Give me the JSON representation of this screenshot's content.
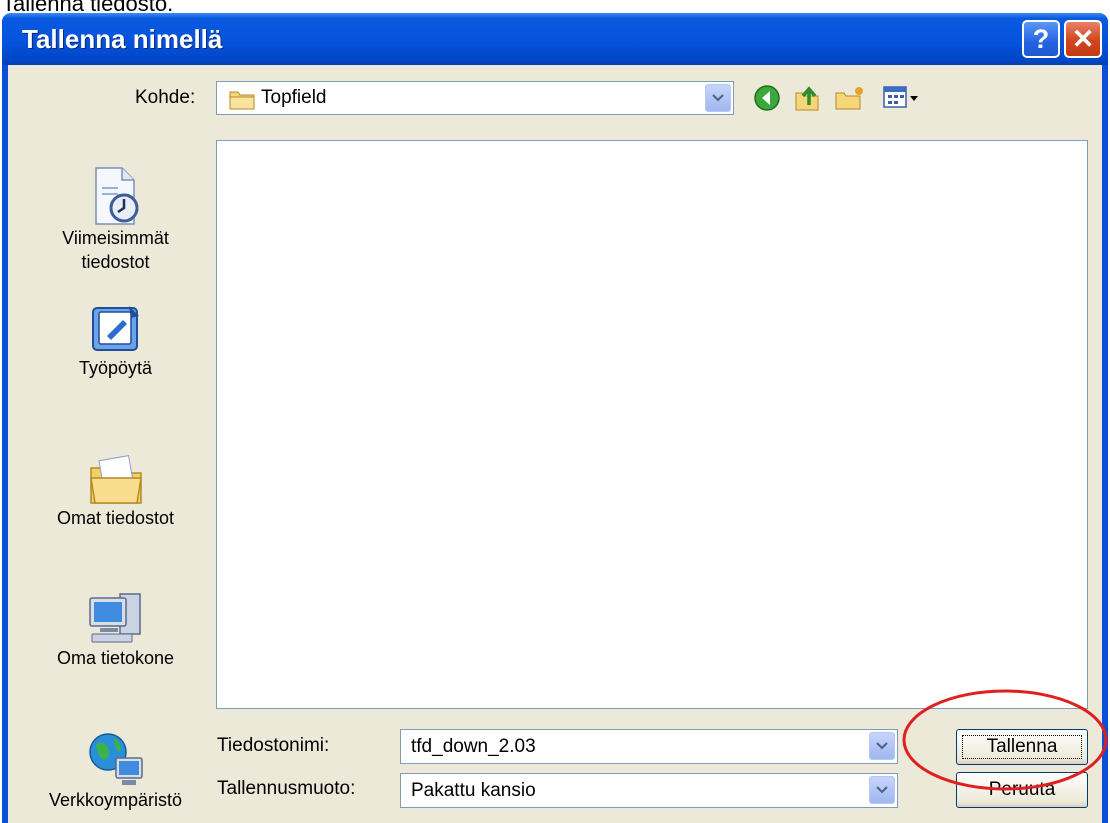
{
  "document_caption": "Tallenna tiedosto.",
  "dialog": {
    "title": "Tallenna nimellä",
    "help_label": "?",
    "close_label": "✕"
  },
  "lookin": {
    "label": "Kohde:",
    "value": "Topfield"
  },
  "toolbar": {
    "icons": [
      "back-icon",
      "up-folder-icon",
      "new-folder-icon",
      "view-menu-icon"
    ]
  },
  "places": [
    {
      "label_line1": "Viimeisimmät",
      "label_line2": "tiedostot",
      "icon": "recent-documents-icon"
    },
    {
      "label_line1": "Työpöytä",
      "label_line2": "",
      "icon": "desktop-icon"
    },
    {
      "label_line1": "Omat tiedostot",
      "label_line2": "",
      "icon": "my-documents-icon"
    },
    {
      "label_line1": "Oma tietokone",
      "label_line2": "",
      "icon": "my-computer-icon"
    },
    {
      "label_line1": "Verkkoympäristö",
      "label_line2": "",
      "icon": "network-icon"
    }
  ],
  "filename": {
    "label": "Tiedostonimi:",
    "value": "tfd_down_2.03"
  },
  "filetype": {
    "label": "Tallennusmuoto:",
    "value": "Pakattu kansio"
  },
  "buttons": {
    "save": "Tallenna",
    "cancel": "Peruuta"
  },
  "colors": {
    "titlebar": "#0654de",
    "dialog_bg": "#ece9d8",
    "highlight_ellipse": "#e02020"
  }
}
